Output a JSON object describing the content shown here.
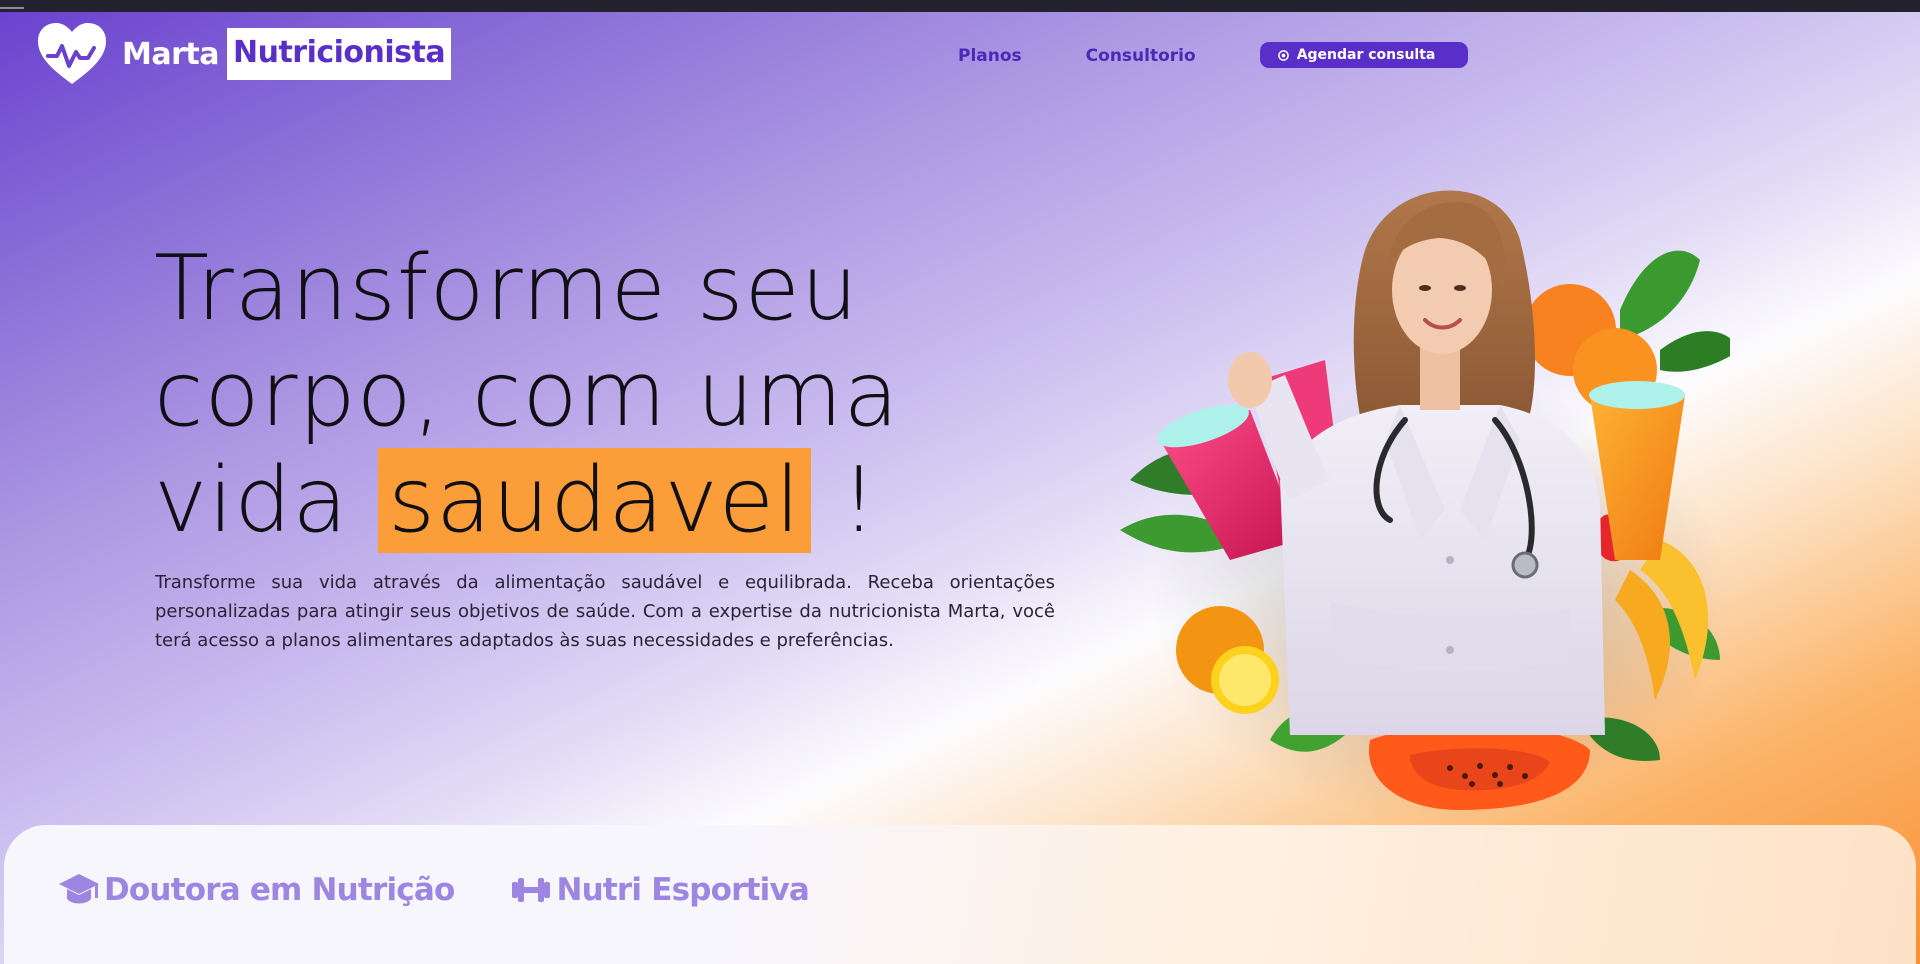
{
  "header": {
    "brand_first": "Marta",
    "brand_second": "Nutricionista",
    "nav": [
      {
        "label": "Planos"
      },
      {
        "label": "Consultorio"
      }
    ],
    "cta_label": "Agendar consulta",
    "cta_icon": "whatsapp-icon",
    "logo_icon": "heart-pulse-icon"
  },
  "hero": {
    "title_line1": "Transforme seu",
    "title_line2": "corpo, com uma",
    "title_line3_prefix": "vida",
    "title_highlight": "saudavel",
    "title_suffix": "!",
    "description": "Transforme sua vida através da alimentação saudável e equilibrada. Receba orientações personalizadas para atingir seus objetivos de saúde. Com a expertise da nutricionista Marta, você terá acesso a planos alimentares adaptados às suas necessidades e preferências."
  },
  "badges": [
    {
      "label": "Doutora em Nutrição",
      "icon": "graduation-cap-icon"
    },
    {
      "label": "Nutri Esportiva",
      "icon": "dumbbell-icon"
    }
  ],
  "colors": {
    "primary": "#5a2fc9",
    "highlight": "#fb9d39",
    "badge_text": "#9c86e2",
    "nav_text": "#4b29b6"
  }
}
